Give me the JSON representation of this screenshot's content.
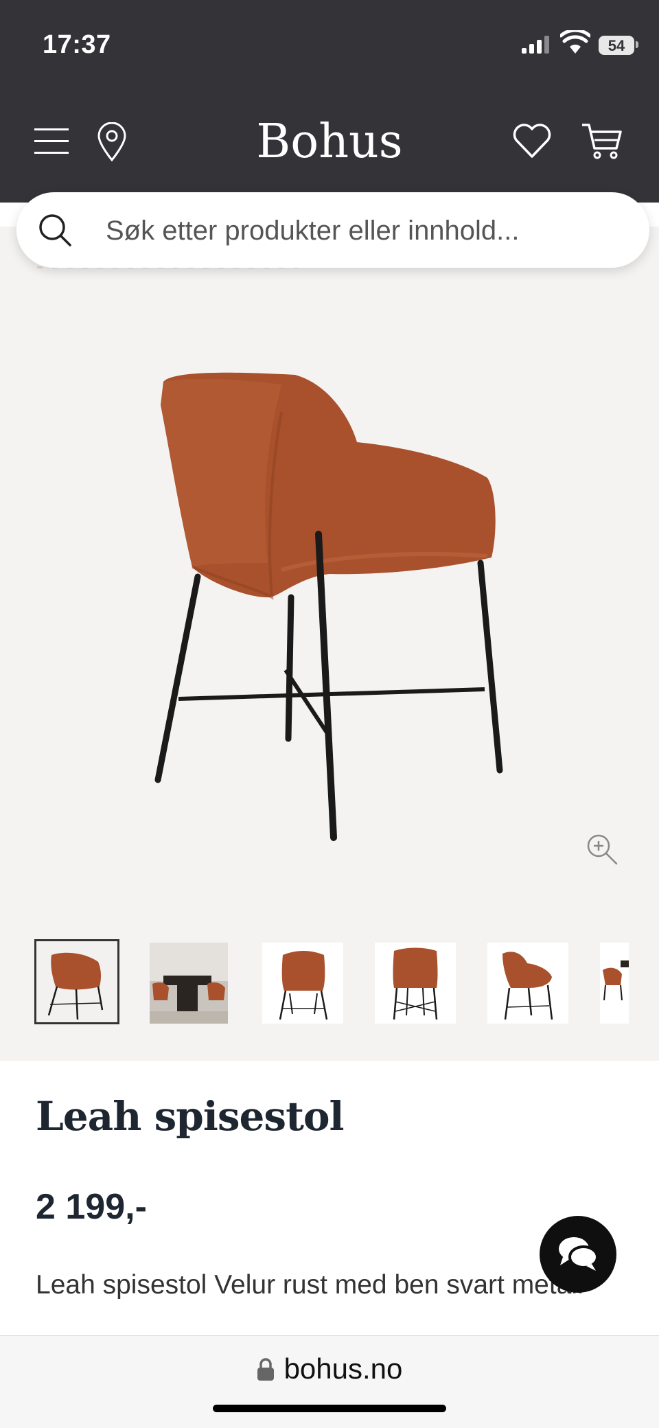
{
  "status_bar": {
    "time": "17:37",
    "battery": "54"
  },
  "header": {
    "logo": "Bohus",
    "icons": [
      "menu-icon",
      "location-pin-icon",
      "heart-icon",
      "cart-icon"
    ]
  },
  "search": {
    "placeholder": "Søk etter produkter eller innhold..."
  },
  "gallery": {
    "thumbnail_count": 6,
    "selected_index": 0
  },
  "product": {
    "title": "Leah spisestol",
    "price": "2 199,-",
    "description": "Leah spisestol Velur rust med ben svart metall"
  },
  "browser": {
    "url": "bohus.no"
  },
  "colors": {
    "header_bg": "#333338",
    "gallery_bg": "#f5f3f1",
    "title_color": "#1e2632",
    "chair_velvet": "#a9512c"
  }
}
